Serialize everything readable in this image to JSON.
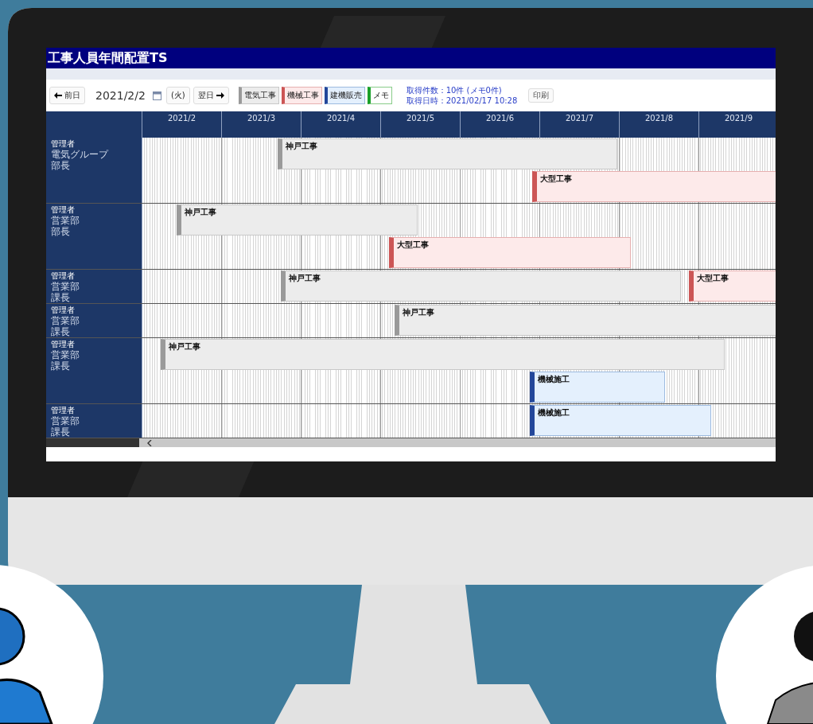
{
  "window": {
    "title": "工事人員年間配置TS"
  },
  "toolbar": {
    "prev": "前日",
    "date": "2021/2/2",
    "weekday": "(火)",
    "next": "翌日",
    "legend": [
      {
        "label": "電気工事",
        "kind": "electric"
      },
      {
        "label": "機械工事",
        "kind": "machine"
      },
      {
        "label": "建機販売",
        "kind": "equipment"
      },
      {
        "label": "メモ",
        "kind": "memo"
      }
    ],
    "info": [
      "取得件数：10件 (メモ0件)",
      "取得日時：2021/02/17 10:28"
    ],
    "print": "印刷"
  },
  "timeline": {
    "months": [
      "2021/2",
      "2021/3",
      "2021/4",
      "2021/5",
      "2021/6",
      "2021/7",
      "2021/8",
      "2021/9"
    ]
  },
  "rows": [
    {
      "name": "管理者",
      "group": "電気グループ",
      "title": "部長",
      "lanes": [
        [
          {
            "label": "神戸工事",
            "kind": "electric"
          }
        ],
        [
          {
            "label": "大型工事",
            "kind": "machine"
          }
        ]
      ]
    },
    {
      "name": "管理者",
      "group": "営業部",
      "title": "部長",
      "lanes": [
        [
          {
            "label": "神戸工事",
            "kind": "electric"
          }
        ],
        [
          {
            "label": "大型工事",
            "kind": "machine"
          }
        ]
      ]
    },
    {
      "name": "管理者",
      "group": "営業部",
      "title": "課長",
      "lanes": [
        [
          {
            "label": "神戸工事",
            "kind": "electric"
          },
          {
            "label": "大型工事",
            "kind": "machine"
          }
        ]
      ]
    },
    {
      "name": "管理者",
      "group": "営業部",
      "title": "課長",
      "lanes": [
        [
          {
            "label": "神戸工事",
            "kind": "electric"
          }
        ]
      ]
    },
    {
      "name": "管理者",
      "group": "営業部",
      "title": "課長",
      "lanes": [
        [
          {
            "label": "神戸工事",
            "kind": "electric"
          }
        ],
        [
          {
            "label": "機械施工",
            "kind": "equipment"
          }
        ]
      ]
    },
    {
      "name": "管理者",
      "group": "営業部",
      "title": "課長",
      "lanes": [
        [
          {
            "label": "機械施工",
            "kind": "equipment"
          }
        ]
      ]
    }
  ]
}
